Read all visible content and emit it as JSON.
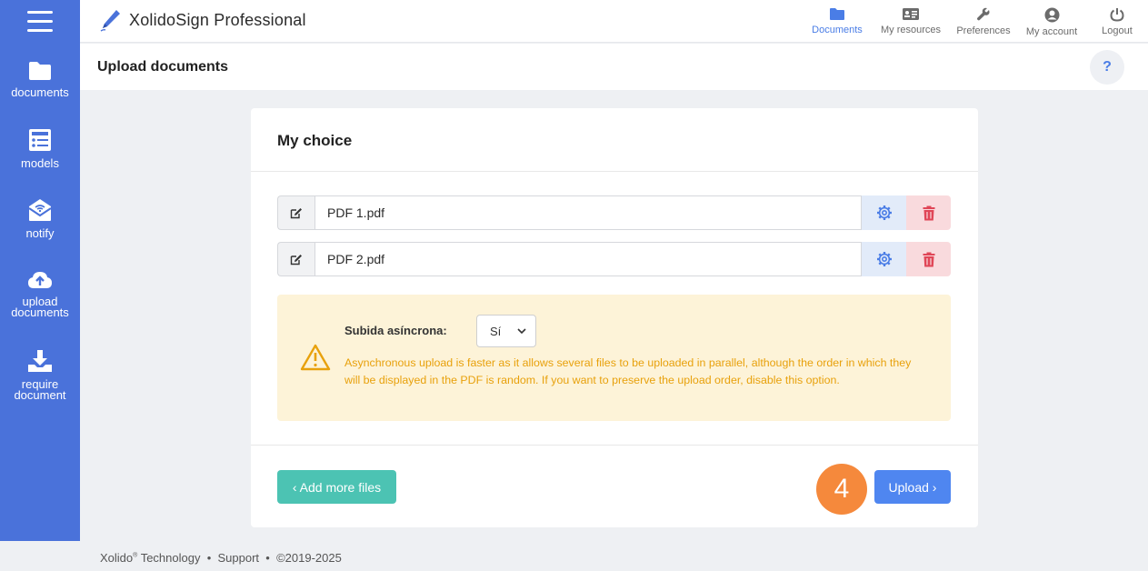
{
  "app": {
    "title": "XolidoSign Professional"
  },
  "sidebar": {
    "items": [
      {
        "label": "documents",
        "icon": "folder-icon"
      },
      {
        "label": "models",
        "icon": "models-icon"
      },
      {
        "label": "notify",
        "icon": "notify-envelope-icon"
      },
      {
        "label_line1": "upload",
        "label_line2": "documents",
        "icon": "cloud-upload-icon"
      },
      {
        "label_line1": "require",
        "label_line2": "document",
        "icon": "download-tray-icon"
      }
    ]
  },
  "topnav": {
    "items": [
      {
        "label": "Documents",
        "active": true
      },
      {
        "label": "My resources"
      },
      {
        "label": "Preferences"
      },
      {
        "label": "My account"
      },
      {
        "label": "Logout"
      }
    ]
  },
  "page": {
    "title": "Upload documents",
    "help": "?"
  },
  "card": {
    "title": "My choice",
    "files": [
      {
        "name": "PDF 1.pdf"
      },
      {
        "name": "PDF 2.pdf"
      }
    ],
    "async": {
      "label": "Subida asíncrona:",
      "selected": "Sí",
      "description": "Asynchronous upload is faster as it allows several files to be uploaded in parallel, although the order in which they will be displayed in the PDF is random. If you want to preserve the upload order, disable this option."
    },
    "add_more_label": "‹ Add more files",
    "step_number": "4",
    "upload_label": "Upload ›"
  },
  "footer": {
    "company": "Xolido",
    "registered": "®",
    "company_suffix": " Technology",
    "sep": "•",
    "support": "Support",
    "copyright": "©2019-2025"
  },
  "colors": {
    "sidebar": "#4a72da",
    "accent": "#4a7de6",
    "success": "#4cc3b3",
    "warning_text": "#e8a10c",
    "warning_bg": "#fdf3d8",
    "danger": "#e04657",
    "step_badge": "#f5893c",
    "primary_button": "#4f86f0"
  }
}
